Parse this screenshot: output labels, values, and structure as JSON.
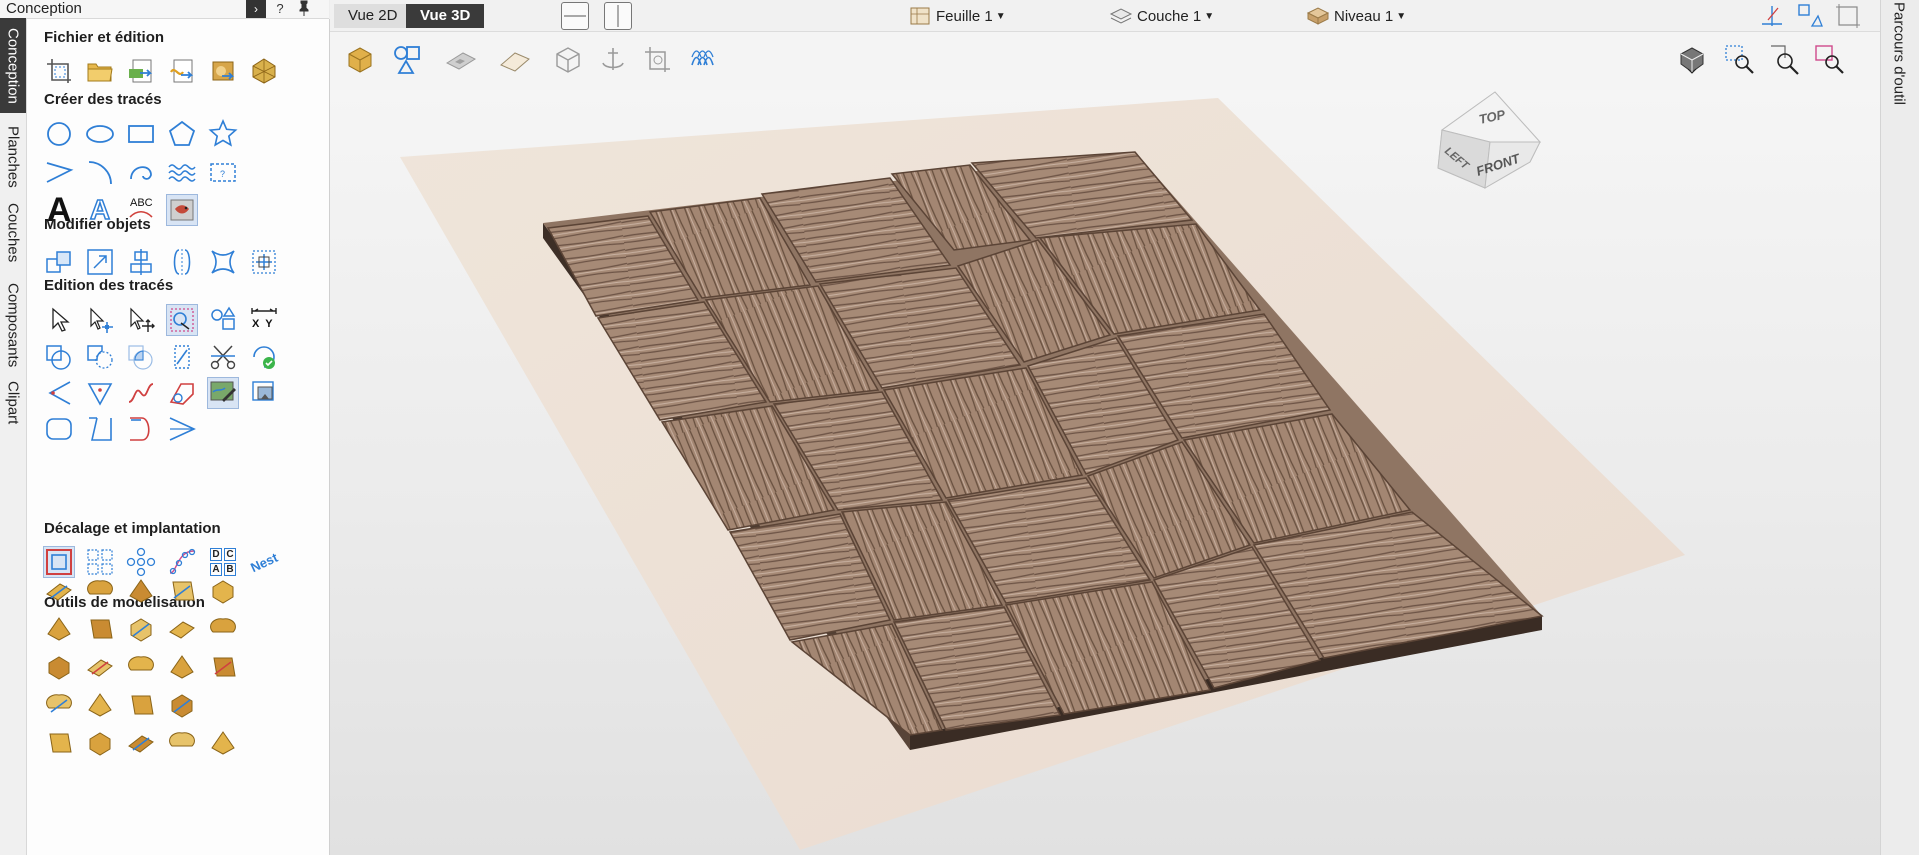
{
  "panel": {
    "title": "Conception",
    "controls": {
      "collapse": "›",
      "help": "?",
      "pin": "📌"
    }
  },
  "vertical_tabs": [
    "Conception",
    "Planches",
    "Couches",
    "Composants",
    "Clipart"
  ],
  "sections": {
    "file": "Fichier et édition",
    "create": "Créer des tracés",
    "modify": "Modifier objets",
    "edit": "Edition des tracés",
    "offset": "Décalage et implantation",
    "modeling": "Outils de modélisation"
  },
  "icon_labels": {
    "text_bold": "A",
    "text_outline": "A",
    "text_arc": "ABC",
    "measure_xy": "X  Y",
    "array_letters": [
      "D",
      "C",
      "A",
      "B"
    ],
    "nesting": "Nest"
  },
  "view_tabs": {
    "v2d": "Vue 2D",
    "v3d": "Vue 3D"
  },
  "dropdowns": {
    "sheet": "Feuille 1",
    "layer": "Couche 1",
    "level": "Niveau 1"
  },
  "right_tab": "Parcours d'outil",
  "view_cube": {
    "top": "TOP",
    "left": "LEFT",
    "front": "FRONT"
  },
  "colors": {
    "icon_blue": "#2f7fd6",
    "icon_gold": "#e2b54a",
    "dark_tab": "#3a3a3a",
    "relief": "#a48874",
    "board": "#efe3d6"
  }
}
